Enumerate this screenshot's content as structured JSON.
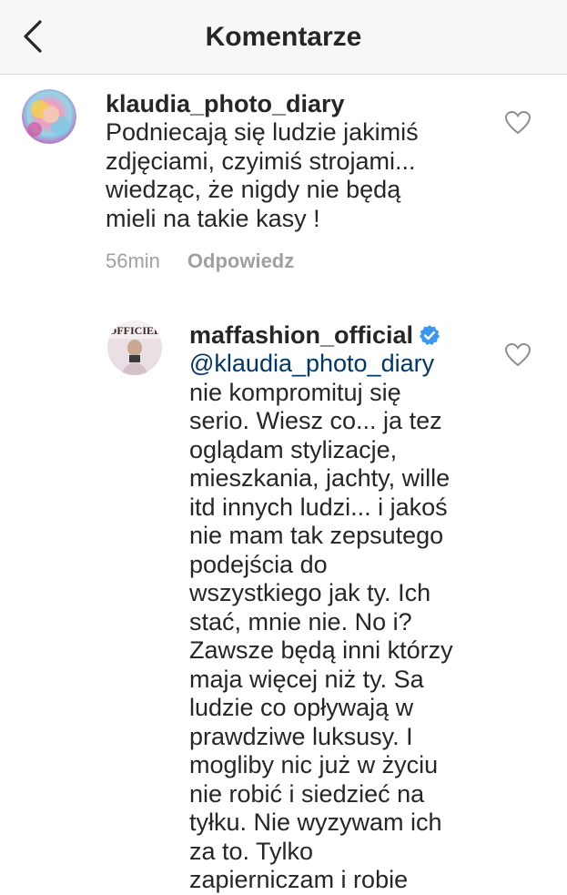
{
  "header": {
    "title": "Komentarze"
  },
  "comments": [
    {
      "username": "klaudia_photo_diary",
      "lines": [
        "Podniecają się ludzie jakimiś",
        "zdjęciami, czyimiś strojami...",
        "wiedząc, że nigdy nie będą",
        "mieli na takie kasy !"
      ],
      "time": "56min",
      "reply_label": "Odpowiedz"
    },
    {
      "username": "maffashion_official",
      "verified": true,
      "mention": "@klaudia_photo_diary",
      "lines": [
        "nie kompromituj się",
        "serio. Wiesz co... ja tez",
        "oglądam stylizacje,",
        "mieszkania, jachty, wille",
        "itd innych ludzi... i jakoś",
        "nie mam tak zepsutego",
        "podejścia do",
        "wszystkiego jak ty. Ich",
        "stać, mnie nie. No i?",
        "Zawsze będą inni którzy",
        "maja więcej niż ty. Sa",
        "ludzie co opływają w",
        "prawdziwe luksusy. I",
        "mogliby nic już w życiu",
        "nie robić i siedzieć na",
        "tyłku. Nie wyzywam ich",
        "za to. Tylko",
        "zapierniczam i robie"
      ],
      "avatar_text": "OFFICIEL"
    }
  ],
  "colors": {
    "header_bg": "#f7f7f7",
    "text": "#262626",
    "meta": "#a0a0a0",
    "mention": "#00376b",
    "verified": "#3897f0"
  }
}
